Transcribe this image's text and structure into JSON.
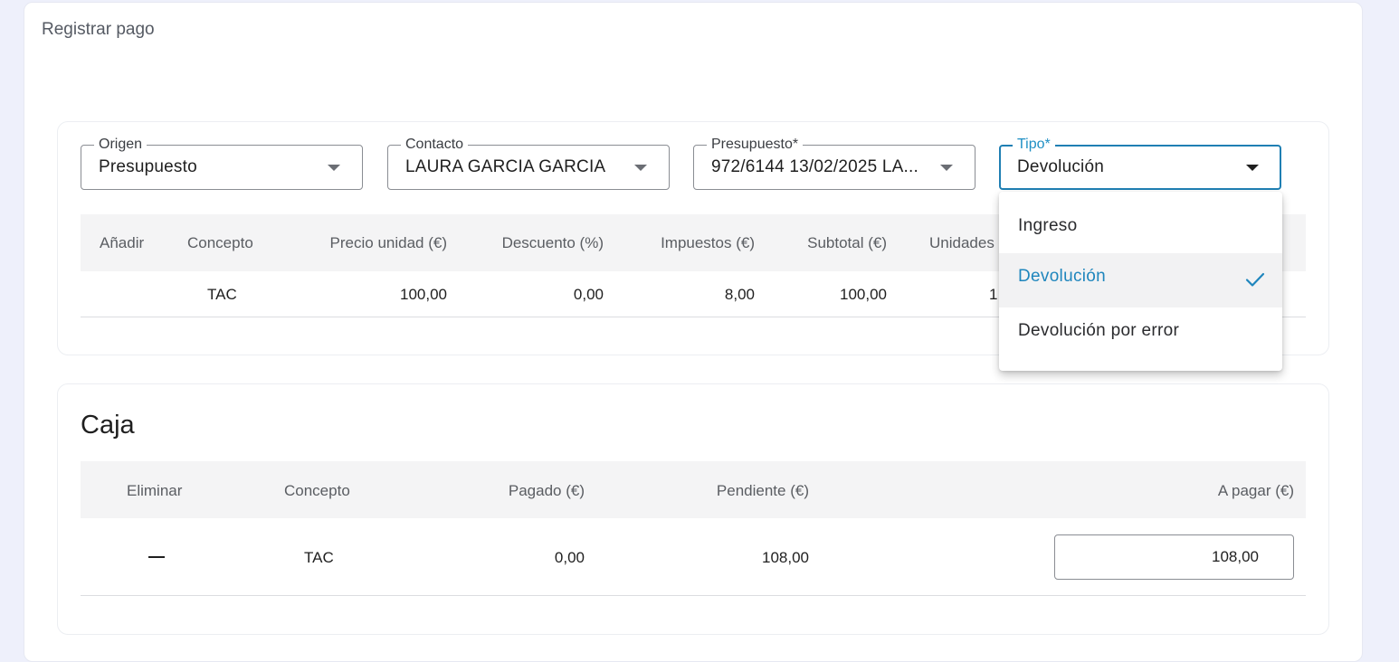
{
  "page": {
    "title": "Registrar pago"
  },
  "filters": {
    "origen": {
      "label": "Origen",
      "value": "Presupuesto"
    },
    "contacto": {
      "label": "Contacto",
      "value": "LAURA GARCIA GARCIA"
    },
    "presupuesto": {
      "label": "Presupuesto*",
      "value": "972/6144 13/02/2025 LA..."
    },
    "tipo": {
      "label": "Tipo*",
      "value": "Devolución"
    }
  },
  "items_table": {
    "headers": [
      "Añadir",
      "Concepto",
      "Precio unidad (€)",
      "Descuento (%)",
      "Impuestos (€)",
      "Subtotal (€)",
      "Unidades"
    ],
    "row": {
      "concepto": "TAC",
      "precio": "100,00",
      "descuento": "0,00",
      "impuestos": "8,00",
      "subtotal": "100,00",
      "unidades": "1"
    }
  },
  "caja": {
    "title": "Caja",
    "headers": [
      "Eliminar",
      "Concepto",
      "Pagado (€)",
      "Pendiente (€)",
      "A pagar (€)"
    ],
    "row": {
      "eliminar_icon": "minus-icon",
      "concepto": "TAC",
      "pagado": "0,00",
      "pendiente": "108,00",
      "a_pagar": "108,00"
    }
  },
  "tipo_menu": {
    "options": [
      "Ingreso",
      "Devolución",
      "Devolución por error"
    ],
    "selected": "Devolución",
    "selected_icon": "check-icon"
  },
  "colors": {
    "accent": "#1f86bd",
    "header_bg": "#f4f4f5",
    "page_bg": "#eef0fb"
  }
}
